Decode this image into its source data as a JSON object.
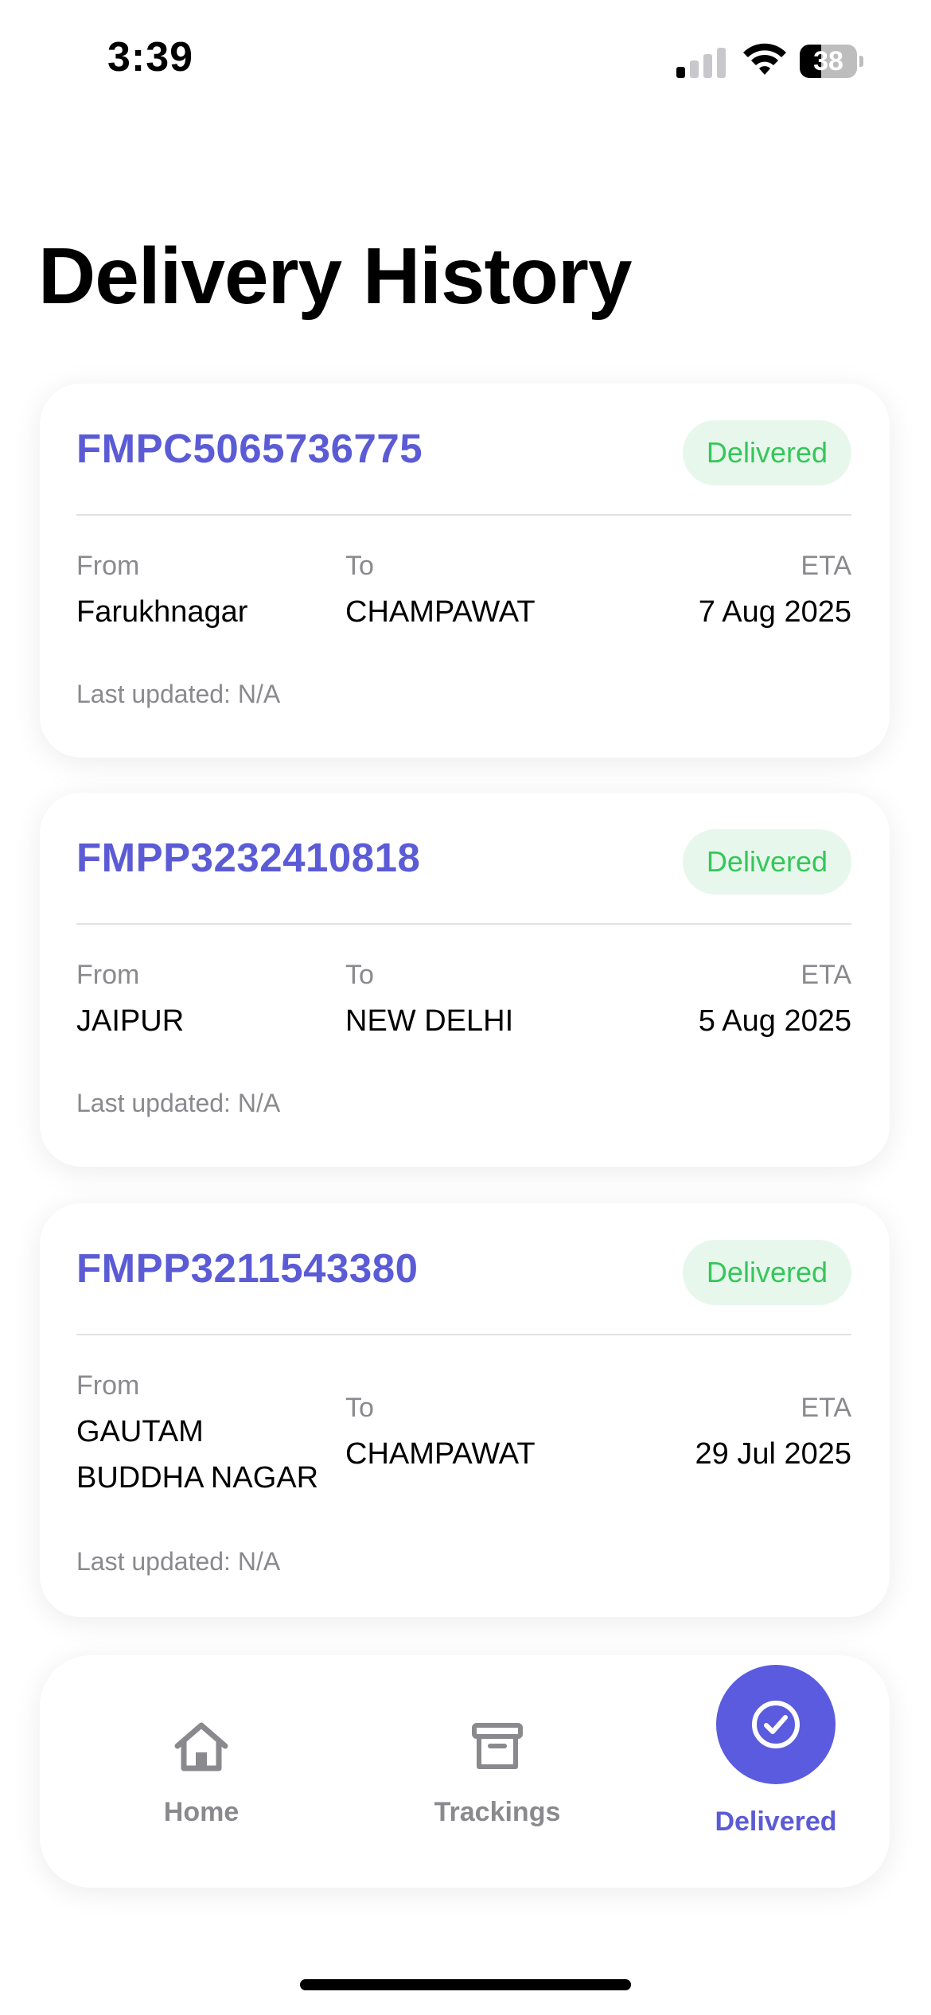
{
  "status_bar": {
    "time": "3:39",
    "battery_level": "38",
    "battery_fraction": 0.38
  },
  "page": {
    "title": "Delivery History"
  },
  "labels": {
    "from": "From",
    "to": "To",
    "eta": "ETA"
  },
  "deliveries": [
    {
      "tracking_id": "FMPC5065736775",
      "status": "Delivered",
      "from": "Farukhnagar",
      "to": "CHAMPAWAT",
      "eta": "7 Aug 2025",
      "last_updated": "Last updated: N/A"
    },
    {
      "tracking_id": "FMPP3232410818",
      "status": "Delivered",
      "from": "JAIPUR",
      "to": "NEW DELHI",
      "eta": "5 Aug 2025",
      "last_updated": "Last updated: N/A"
    },
    {
      "tracking_id": "FMPP3211543380",
      "status": "Delivered",
      "from_line1": "GAUTAM",
      "from_line2": "BUDDHA NAGAR",
      "to": "CHAMPAWAT",
      "eta": "29 Jul 2025",
      "last_updated": "Last updated: N/A"
    }
  ],
  "tab_bar": {
    "tabs": [
      {
        "label": "Home",
        "icon": "home-icon",
        "active": false
      },
      {
        "label": "Trackings",
        "icon": "archive-box-icon",
        "active": false
      },
      {
        "label": "Delivered",
        "icon": "check-circle-icon",
        "active": true
      }
    ]
  },
  "colors": {
    "accent": "#5b5bd6",
    "status_green": "#34c759",
    "status_green_bg": "#e8f7ec",
    "muted_text": "#8a8a8e"
  }
}
